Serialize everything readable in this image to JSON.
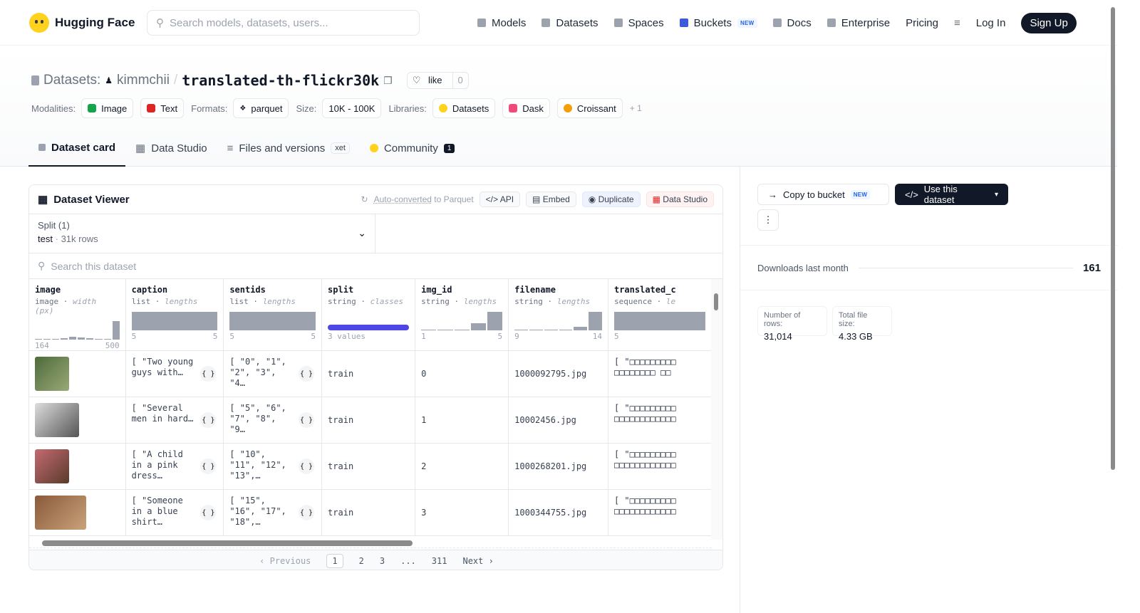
{
  "nav": {
    "brand": "Hugging Face",
    "search_placeholder": "Search models, datasets, users...",
    "links": [
      "Models",
      "Datasets",
      "Spaces",
      "Buckets",
      "Docs",
      "Enterprise",
      "Pricing"
    ],
    "new_badge": "NEW",
    "login": "Log In",
    "signup": "Sign Up"
  },
  "header": {
    "prefix": "Datasets:",
    "owner": "kimmchii",
    "sep": "/",
    "name": "translated-th-flickr30k",
    "like": "like",
    "likes": "0"
  },
  "tags": {
    "modalities_label": "Modalities:",
    "modalities": [
      "Image",
      "Text"
    ],
    "formats_label": "Formats:",
    "format": "parquet",
    "size_label": "Size:",
    "size": "10K - 100K",
    "libraries_label": "Libraries:",
    "libraries": [
      "Datasets",
      "Dask",
      "Croissant"
    ],
    "more": "+ 1"
  },
  "tabs": {
    "card": "Dataset card",
    "studio": "Data Studio",
    "files": "Files and versions",
    "xet": "xet",
    "community": "Community",
    "community_count": "1"
  },
  "viewer": {
    "title": "Dataset Viewer",
    "auto": "Auto-converted",
    "auto_rest": "to Parquet",
    "api": "API",
    "embed": "Embed",
    "duplicate": "Duplicate",
    "studio": "Data Studio",
    "split_label": "Split (1)",
    "split_value": "test",
    "split_rows": "31k rows",
    "search_placeholder": "Search this dataset",
    "columns": [
      {
        "name": "image",
        "type": "image",
        "sub": "width (px)",
        "min": "164",
        "max": "500"
      },
      {
        "name": "caption",
        "type": "list",
        "sub": "lengths",
        "min": "5",
        "max": "5"
      },
      {
        "name": "sentids",
        "type": "list",
        "sub": "lengths",
        "min": "5",
        "max": "5"
      },
      {
        "name": "split",
        "type": "string",
        "sub": "classes",
        "min": "3 values",
        "max": ""
      },
      {
        "name": "img_id",
        "type": "string",
        "sub": "lengths",
        "min": "1",
        "max": "5"
      },
      {
        "name": "filename",
        "type": "string",
        "sub": "lengths",
        "min": "9",
        "max": "14"
      },
      {
        "name": "translated_c",
        "type": "sequence",
        "sub": "le",
        "min": "5",
        "max": ""
      }
    ],
    "rows": [
      {
        "caption": "[ \"Two young guys with…",
        "sentids": "[ \"0\", \"1\", \"2\", \"3\", \"4…",
        "split": "train",
        "img_id": "0",
        "filename": "1000092795.jpg",
        "translated": "[ \"□□□□□□□□□ □□□□□□□□ □□"
      },
      {
        "caption": "[ \"Several men in hard…",
        "sentids": "[ \"5\", \"6\", \"7\", \"8\", \"9…",
        "split": "train",
        "img_id": "1",
        "filename": "10002456.jpg",
        "translated": "[ \"□□□□□□□□□ □□□□□□□□□□□□"
      },
      {
        "caption": "[ \"A child in a pink dress…",
        "sentids": "[ \"10\", \"11\", \"12\", \"13\",…",
        "split": "train",
        "img_id": "2",
        "filename": "1000268201.jpg",
        "translated": "[ \"□□□□□□□□□ □□□□□□□□□□□□"
      },
      {
        "caption": "[ \"Someone in a blue shirt…",
        "sentids": "[ \"15\", \"16\", \"17\", \"18\",…",
        "split": "train",
        "img_id": "3",
        "filename": "1000344755.jpg",
        "translated": "[ \"□□□□□□□□□ □□□□□□□□□□□□"
      }
    ],
    "pager": {
      "prev": "Previous",
      "pages": [
        "1",
        "2",
        "3",
        "...",
        "311"
      ],
      "next": "Next"
    }
  },
  "sidebar": {
    "copy": "Copy to bucket",
    "new": "NEW",
    "use": "Use this dataset",
    "downloads_label": "Downloads last month",
    "downloads": "161",
    "rows_label": "Number of rows:",
    "rows": "31,014",
    "size_label": "Total file size:",
    "size": "4.33 GB"
  }
}
